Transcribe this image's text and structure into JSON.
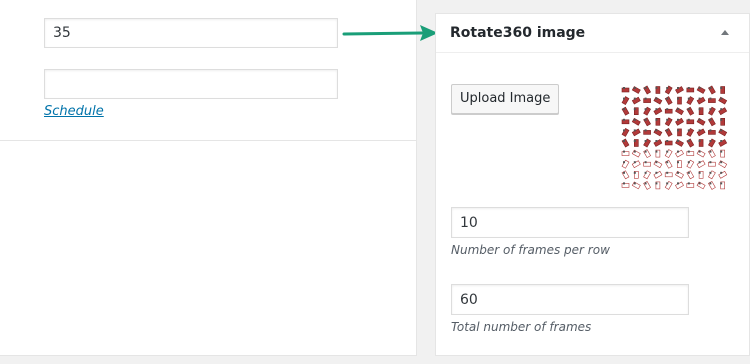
{
  "fields": {
    "top_value": "35",
    "second_value": ""
  },
  "schedule_link": "Schedule",
  "arrow_color": "#1a9e78",
  "meta_box": {
    "title": "Rotate360 image",
    "upload_button": "Upload Image",
    "frames_per_row": {
      "value": "10",
      "description": "Number of frames per row"
    },
    "total_frames": {
      "value": "60",
      "description": "Total number of frames"
    },
    "preview_icon": "sprite-sheet-thumbnail"
  },
  "colors": {
    "link": "#0073aa",
    "sprite_red": "#b23a3a",
    "sprite_dark": "#555555"
  }
}
